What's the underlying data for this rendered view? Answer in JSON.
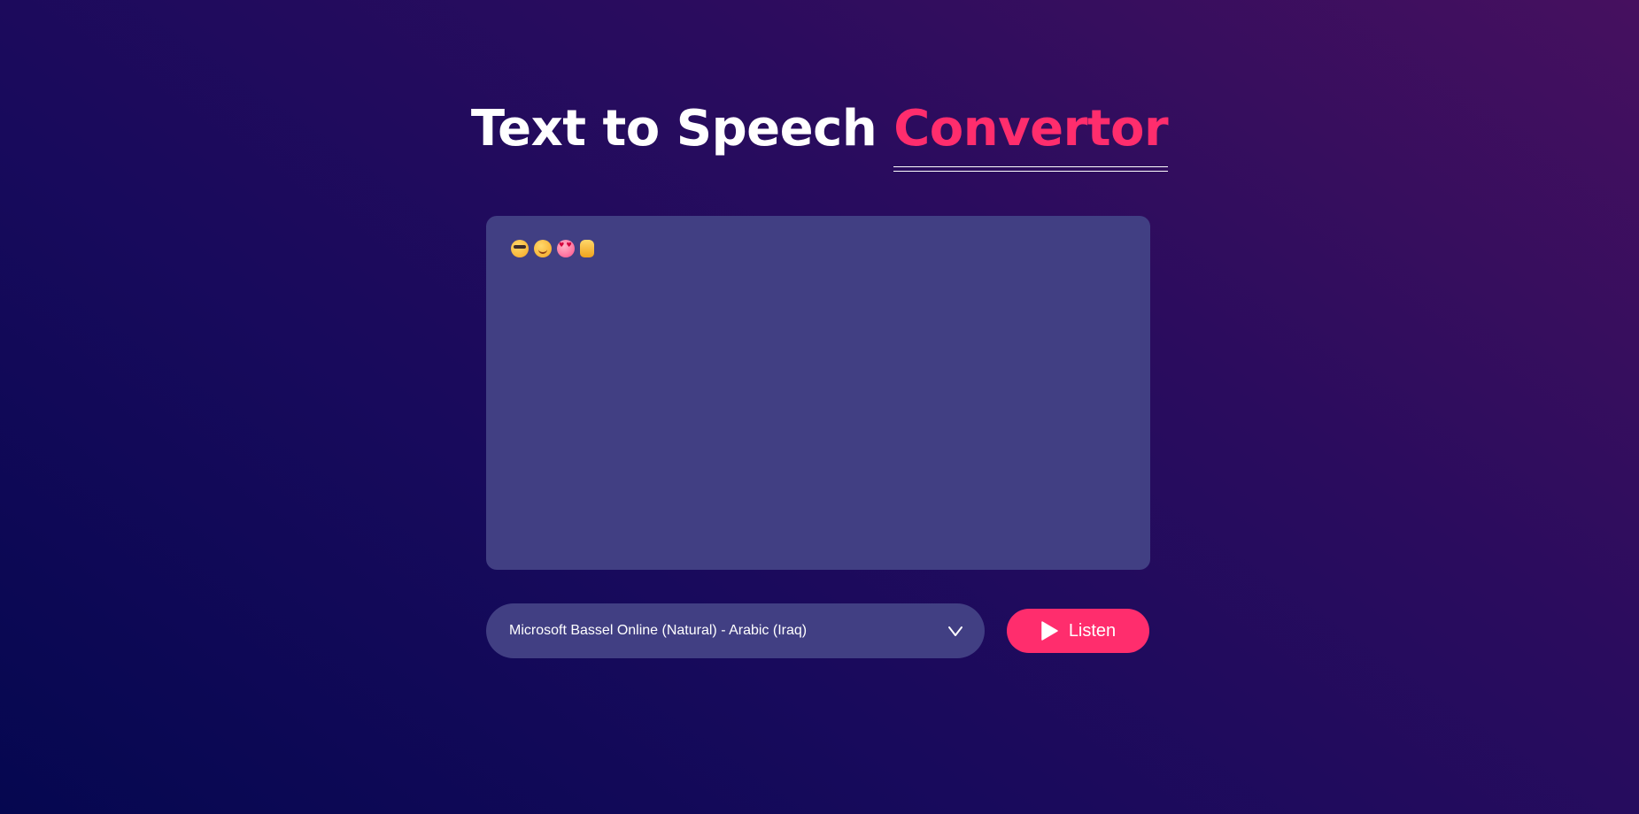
{
  "header": {
    "title_main": "Text to Speech",
    "title_accent": "Convertor"
  },
  "editor": {
    "content_icons": [
      "smiling-face-with-sunglasses-icon",
      "face-savoring-food-icon",
      "smiling-face-with-heart-eyes-icon",
      "thumbs-up-icon"
    ]
  },
  "controls": {
    "voice_selected": "Microsoft Bassel Online (Natural) - Arabic (Iraq)",
    "listen_label": "Listen"
  },
  "colors": {
    "accent": "#ff2d6d",
    "panel": "#413f83",
    "background_start": "#050750",
    "background_end": "#46105f"
  }
}
